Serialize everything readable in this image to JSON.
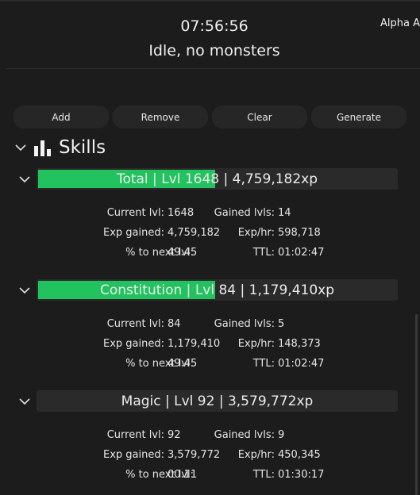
{
  "header": {
    "time": "07:56:56",
    "status": "Idle, no monsters",
    "plugin_label": "Alpha A"
  },
  "toolbar": {
    "add": "Add",
    "remove": "Remove",
    "clear": "Clear",
    "generate": "Generate"
  },
  "section": {
    "title": "Skills",
    "icon": "bar-chart-icon"
  },
  "skills": [
    {
      "label": "Total | Lvl 1648 | 4,759,182xp",
      "progress_fraction": 0.4945,
      "current_lvl_label": "Current lvl:",
      "current_lvl": "1648",
      "gained_lvls_label": "Gained lvls:",
      "gained_lvls": "14",
      "exp_gained_label": "Exp gained:",
      "exp_gained": "4,759,182",
      "exp_hr_label": "Exp/hr:",
      "exp_hr": "598,718",
      "pct_next_label": "% to next lvl:",
      "pct_next": "49.45",
      "ttl_label": "TTL:",
      "ttl": "01:02:47"
    },
    {
      "label": "Constitution | Lvl 84 | 1,179,410xp",
      "progress_fraction": 0.4945,
      "current_lvl_label": "Current lvl:",
      "current_lvl": "84",
      "gained_lvls_label": "Gained lvls:",
      "gained_lvls": "5",
      "exp_gained_label": "Exp gained:",
      "exp_gained": "1,179,410",
      "exp_hr_label": "Exp/hr:",
      "exp_hr": "148,373",
      "pct_next_label": "% to next lvl:",
      "pct_next": "49.45",
      "ttl_label": "TTL:",
      "ttl": "01:02:47"
    },
    {
      "label": "Magic | Lvl 92 | 3,579,772xp",
      "progress_fraction": 0.0011,
      "current_lvl_label": "Current lvl:",
      "current_lvl": "92",
      "gained_lvls_label": "Gained lvls:",
      "gained_lvls": "9",
      "exp_gained_label": "Exp gained:",
      "exp_gained": "3,579,772",
      "exp_hr_label": "Exp/hr:",
      "exp_hr": "450,345",
      "pct_next_label": "% to next lvl:",
      "pct_next": "00.11",
      "ttl_label": "TTL:",
      "ttl": "01:30:17"
    }
  ],
  "colors": {
    "progress": "#22c25f",
    "background": "#1c1c1c",
    "button": "#262626"
  }
}
